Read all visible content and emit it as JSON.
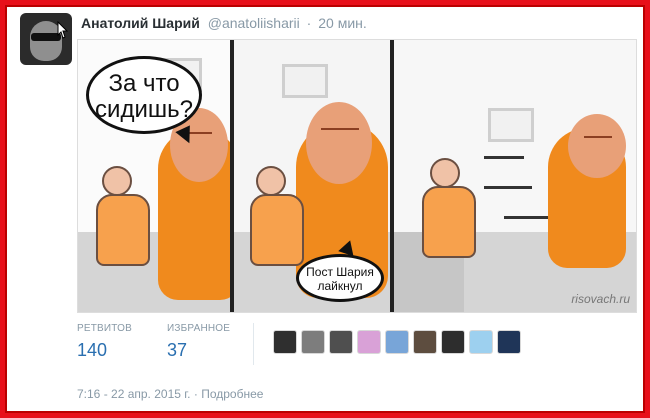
{
  "tweet": {
    "author_name": "Анатолий Шарий",
    "author_handle": "@anatoliisharii",
    "separator": "·",
    "relative_time": "20 мин.",
    "comic_text_1": "За что сидишь?",
    "comic_text_2": "Пост Шария лайкнул",
    "watermark": "risovach.ru"
  },
  "stats": {
    "retweets_label": "РЕТВИТОВ",
    "retweets_value": "140",
    "favorites_label": "ИЗБРАННОЕ",
    "favorites_value": "37"
  },
  "footer": {
    "timestamp": "7:16 - 22 апр. 2015 г.",
    "separator": "·",
    "details_link": "Подробнее"
  },
  "mini_avatars": [
    {
      "icon": "profile-avatar-1",
      "color": "#2f2f2f"
    },
    {
      "icon": "profile-avatar-2",
      "color": "#7d7d7d"
    },
    {
      "icon": "profile-avatar-3",
      "color": "#4f4f4f"
    },
    {
      "icon": "profile-avatar-4",
      "color": "#d9a1d7"
    },
    {
      "icon": "profile-avatar-5",
      "color": "#78a5d8"
    },
    {
      "icon": "profile-avatar-6",
      "color": "#5d4d3f"
    },
    {
      "icon": "profile-avatar-7",
      "color": "#2d2d2d"
    },
    {
      "icon": "profile-avatar-8",
      "color": "#9dd0ef"
    },
    {
      "icon": "profile-avatar-9",
      "color": "#1f3558"
    }
  ],
  "colors": {
    "border": "#e8101a",
    "link": "#2a6fb0",
    "muted": "#8899a6",
    "prisoner_orange": "#f08a1d"
  }
}
